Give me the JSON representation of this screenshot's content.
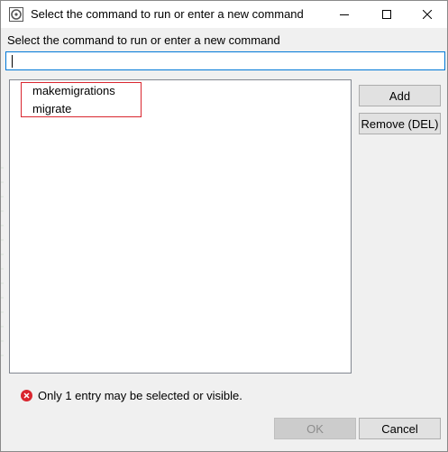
{
  "window": {
    "title": "Select the command to run or enter a new command",
    "title_icon": "eclipse-dialog-icon"
  },
  "controls": {
    "minimize_icon": "minimize-icon",
    "maximize_icon": "maximize-icon",
    "close_icon": "close-icon"
  },
  "prompt": {
    "label": "Select the command to run or enter a new command"
  },
  "command_input": {
    "value": "",
    "placeholder": ""
  },
  "commands": {
    "items": [
      "makemigrations",
      "migrate"
    ]
  },
  "buttons": {
    "add": "Add",
    "remove": "Remove (DEL)",
    "ok": "OK",
    "cancel": "Cancel"
  },
  "status": {
    "icon": "error-icon",
    "message": "Only 1 entry may be selected or visible."
  },
  "colors": {
    "accent": "#0078d7",
    "highlight_border": "#d9262f",
    "error": "#d9262f"
  }
}
